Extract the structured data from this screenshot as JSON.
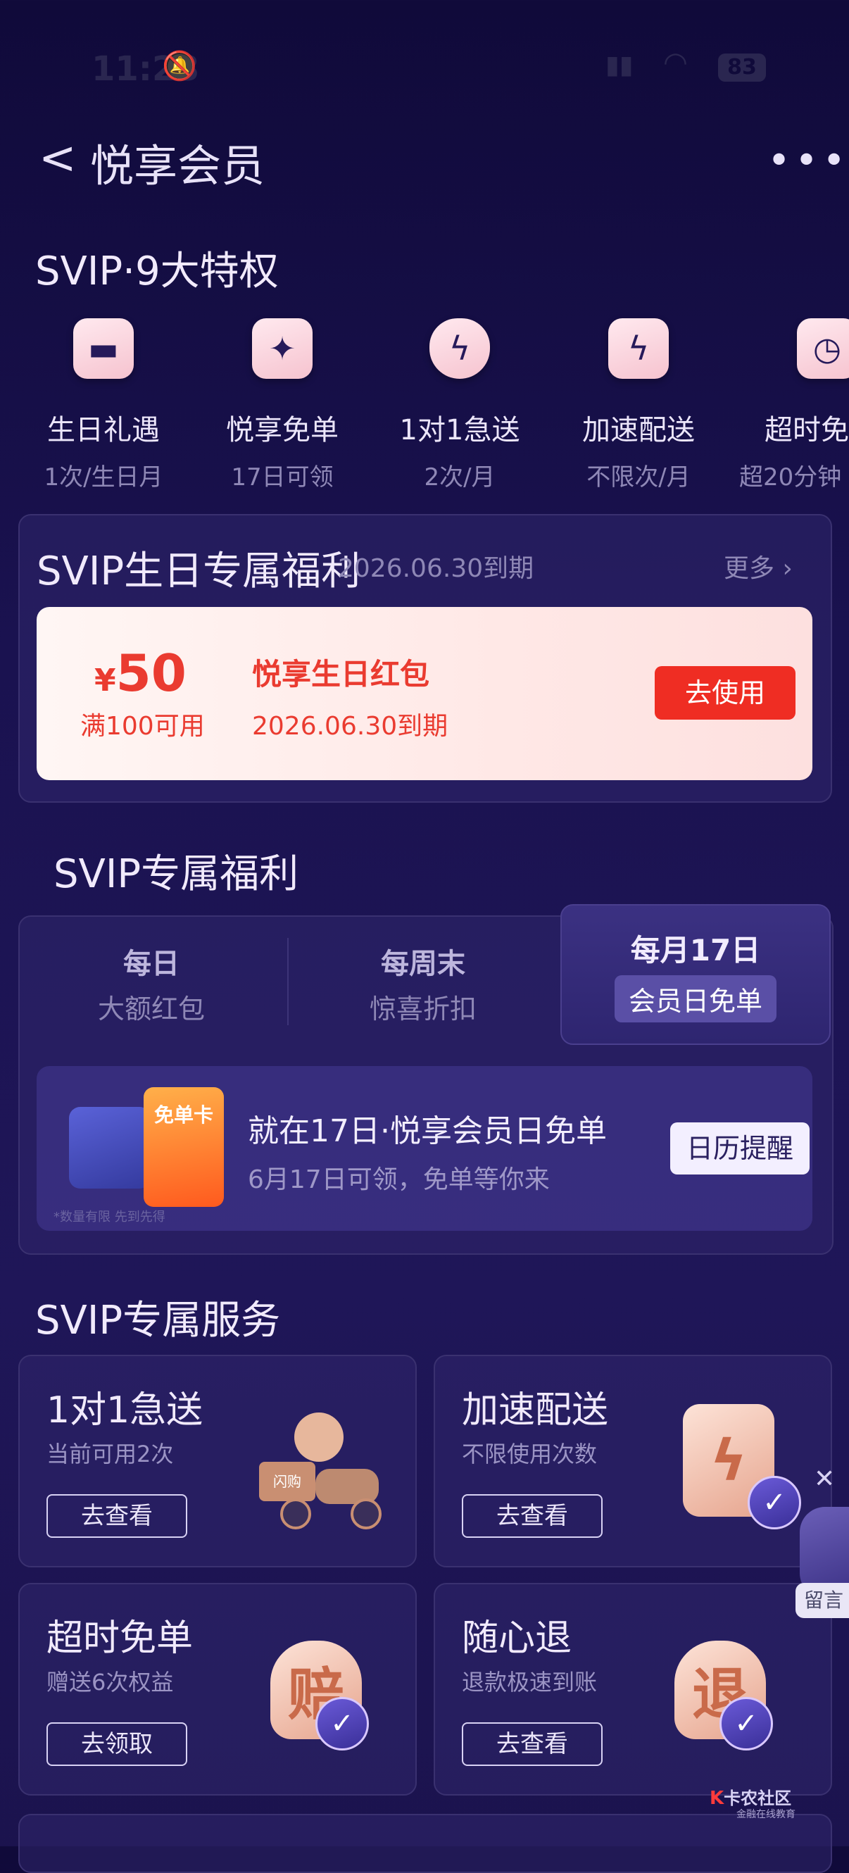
{
  "status": {
    "time": "11:28",
    "battery": "83"
  },
  "header": {
    "title": "悦享会员",
    "back_label": "<",
    "more_label": "•••"
  },
  "privileges": {
    "title": "SVIP·9大特权",
    "items": [
      {
        "name": "生日礼遇",
        "sub": "1次/生日月",
        "icon": "cake-icon",
        "glyph": "▬"
      },
      {
        "name": "悦享免单",
        "sub": "17日可领",
        "icon": "cup-icon",
        "glyph": "✦"
      },
      {
        "name": "1对1急送",
        "sub": "2次/月",
        "icon": "shield-bolt-icon",
        "glyph": "ϟ"
      },
      {
        "name": "加速配送",
        "sub": "不限次/月",
        "icon": "bolt-icon",
        "glyph": "ϟ"
      },
      {
        "name": "超时免",
        "sub": "超20分钟",
        "icon": "clock-icon",
        "glyph": "◷"
      }
    ]
  },
  "birthday": {
    "title": "SVIP生日专属福利",
    "expire": "2026.06.30到期",
    "more": "更多",
    "coupon": {
      "currency": "¥",
      "amount": "50",
      "condition": "满100可用",
      "name": "悦享生日红包",
      "expire": "2026.06.30到期",
      "button": "去使用"
    }
  },
  "exclusive": {
    "title": "SVIP专属福利",
    "tabs": [
      {
        "t1": "每日",
        "t2": "大额红包"
      },
      {
        "t1": "每周末",
        "t2": "惊喜折扣"
      },
      {
        "t1": "每月17日",
        "t2": "会员日免单"
      }
    ],
    "promo": {
      "title": "就在17日·悦享会员日免单",
      "desc": "6月17日可领，免单等你来",
      "button": "日历提醒",
      "card_label": "免单卡",
      "note": "*数量有限 先到先得"
    }
  },
  "services": {
    "title": "SVIP专属服务",
    "items": [
      {
        "title": "1对1急送",
        "desc": "当前可用2次",
        "button": "去查看",
        "glyph": "闪购"
      },
      {
        "title": "加速配送",
        "desc": "不限使用次数",
        "button": "去查看",
        "glyph": "ϟ"
      },
      {
        "title": "超时免单",
        "desc": "赠送6次权益",
        "button": "去领取",
        "glyph": "赔"
      },
      {
        "title": "随心退",
        "desc": "退款极速到账",
        "button": "去查看",
        "glyph": "退"
      }
    ]
  },
  "floating": {
    "close": "✕",
    "label": "留言"
  },
  "watermark": {
    "text": "卡农社区",
    "sub": "金融在线教育"
  }
}
